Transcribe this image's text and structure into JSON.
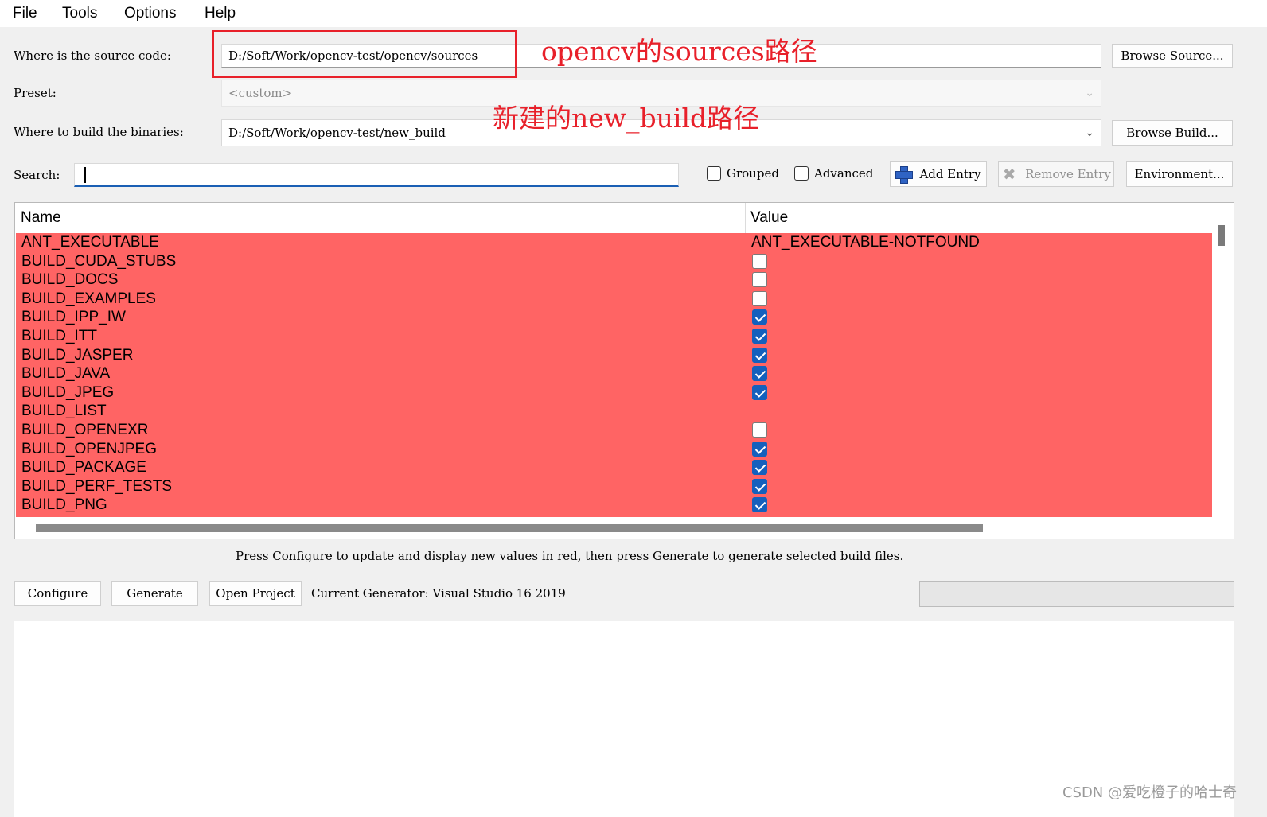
{
  "menu": [
    "File",
    "Tools",
    "Options",
    "Help"
  ],
  "source": {
    "label": "Where is the source code:",
    "value": "D:/Soft/Work/opencv-test/opencv/sources",
    "browse": "Browse Source..."
  },
  "preset": {
    "label": "Preset:",
    "value": "<custom>"
  },
  "build": {
    "label": "Where to build the binaries:",
    "value": "D:/Soft/Work/opencv-test/new_build",
    "browse": "Browse Build..."
  },
  "search": {
    "label": "Search:",
    "value": ""
  },
  "toolbar": {
    "grouped": "Grouped",
    "advanced": "Advanced",
    "add_entry": "Add Entry",
    "remove_entry": "Remove Entry",
    "environment": "Environment..."
  },
  "table": {
    "headers": {
      "name": "Name",
      "value": "Value"
    },
    "rows": [
      {
        "name": "ANT_EXECUTABLE",
        "type": "text",
        "value": "ANT_EXECUTABLE-NOTFOUND"
      },
      {
        "name": "BUILD_CUDA_STUBS",
        "type": "bool",
        "checked": false
      },
      {
        "name": "BUILD_DOCS",
        "type": "bool",
        "checked": false
      },
      {
        "name": "BUILD_EXAMPLES",
        "type": "bool",
        "checked": false
      },
      {
        "name": "BUILD_IPP_IW",
        "type": "bool",
        "checked": true
      },
      {
        "name": "BUILD_ITT",
        "type": "bool",
        "checked": true
      },
      {
        "name": "BUILD_JASPER",
        "type": "bool",
        "checked": true
      },
      {
        "name": "BUILD_JAVA",
        "type": "bool",
        "checked": true
      },
      {
        "name": "BUILD_JPEG",
        "type": "bool",
        "checked": true
      },
      {
        "name": "BUILD_LIST",
        "type": "text",
        "value": ""
      },
      {
        "name": "BUILD_OPENEXR",
        "type": "bool",
        "checked": false
      },
      {
        "name": "BUILD_OPENJPEG",
        "type": "bool",
        "checked": true
      },
      {
        "name": "BUILD_PACKAGE",
        "type": "bool",
        "checked": true
      },
      {
        "name": "BUILD_PERF_TESTS",
        "type": "bool",
        "checked": true
      },
      {
        "name": "BUILD_PNG",
        "type": "bool",
        "checked": true
      }
    ]
  },
  "status_text": "Press Configure to update and display new values in red, then press Generate to generate selected build files.",
  "actions": {
    "configure": "Configure",
    "generate": "Generate",
    "open_project": "Open Project",
    "generator": "Current Generator: Visual Studio 16 2019"
  },
  "annotations": {
    "source_note": "opencv的sources路径",
    "build_note": "新建的new_build路径"
  },
  "watermark": "CSDN @爱吃橙子的哈士奇",
  "colors": {
    "row_highlight": "#ff6464",
    "annotation": "#e8202a",
    "checkbox_on": "#1560bd"
  }
}
